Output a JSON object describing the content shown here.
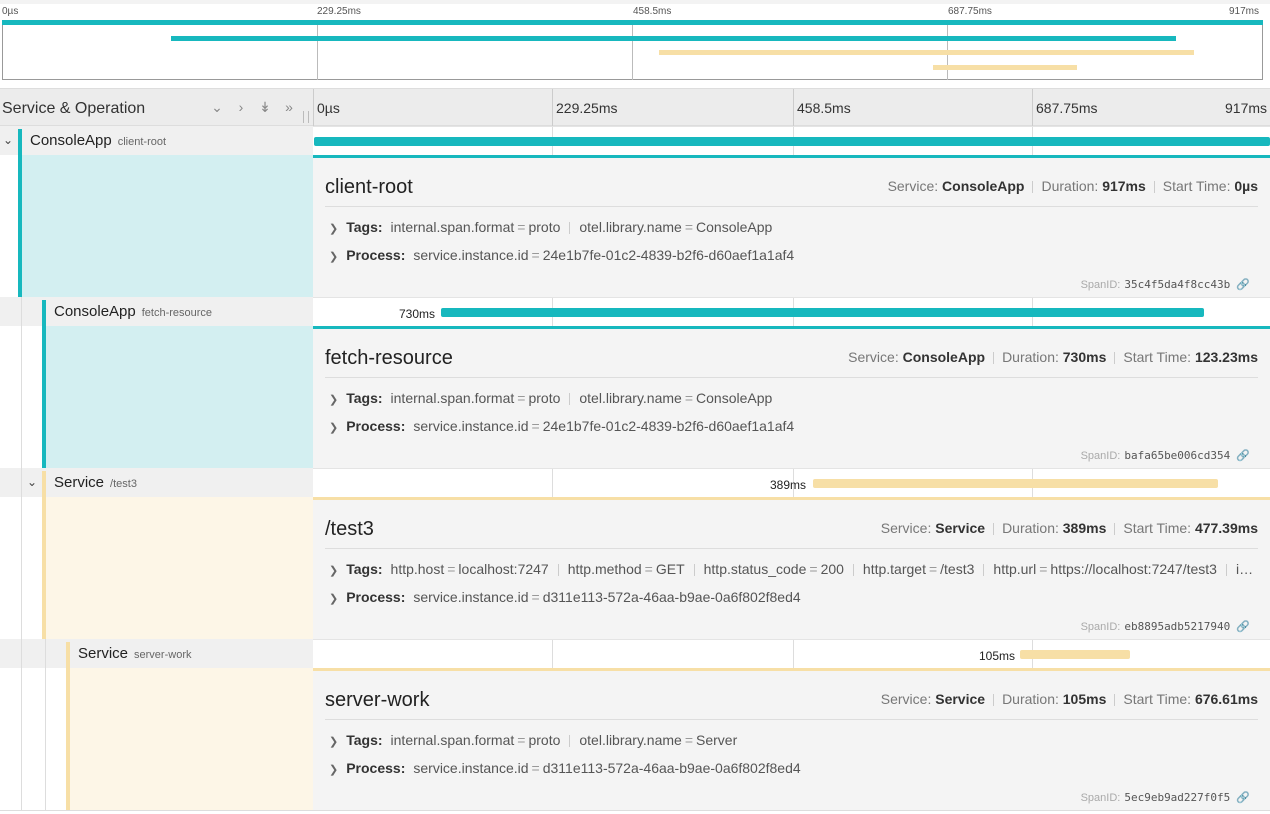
{
  "colors": {
    "client": "#17b8be",
    "server": "#f7dfa6",
    "client_bg": "#d3eff1",
    "server_bg": "#fdf6e7"
  },
  "minimap": {
    "ticks": [
      "0µs",
      "229.25ms",
      "458.5ms",
      "687.75ms",
      "917ms"
    ]
  },
  "header": {
    "title": "Service & Operation",
    "icons": [
      "chevron-down-icon",
      "chevron-right-icon",
      "double-chevron-down-icon",
      "double-chevron-right-icon"
    ],
    "ticks": [
      "0µs",
      "229.25ms",
      "458.5ms",
      "687.75ms",
      "917ms"
    ]
  },
  "spans": [
    {
      "service": "ConsoleApp",
      "operation": "client-root",
      "duration_label": "",
      "title": "client-root",
      "meta": {
        "service_label": "Service:",
        "service": "ConsoleApp",
        "duration_label": "Duration:",
        "duration": "917ms",
        "start_label": "Start Time:",
        "start": "0µs"
      },
      "tags_label": "Tags:",
      "tags": [
        {
          "k": "internal.span.format",
          "v": "proto"
        },
        {
          "k": "otel.library.name",
          "v": "ConsoleApp"
        }
      ],
      "process_label": "Process:",
      "process": [
        {
          "k": "service.instance.id",
          "v": "24e1b7fe-01c2-4839-b2f6-d60aef1a1af4"
        }
      ],
      "spanid_label": "SpanID:",
      "spanid": "35c4f5da4f8cc43b"
    },
    {
      "service": "ConsoleApp",
      "operation": "fetch-resource",
      "duration_label": "730ms",
      "title": "fetch-resource",
      "meta": {
        "service_label": "Service:",
        "service": "ConsoleApp",
        "duration_label": "Duration:",
        "duration": "730ms",
        "start_label": "Start Time:",
        "start": "123.23ms"
      },
      "tags_label": "Tags:",
      "tags": [
        {
          "k": "internal.span.format",
          "v": "proto"
        },
        {
          "k": "otel.library.name",
          "v": "ConsoleApp"
        }
      ],
      "process_label": "Process:",
      "process": [
        {
          "k": "service.instance.id",
          "v": "24e1b7fe-01c2-4839-b2f6-d60aef1a1af4"
        }
      ],
      "spanid_label": "SpanID:",
      "spanid": "bafa65be006cd354"
    },
    {
      "service": "Service",
      "operation": "/test3",
      "duration_label": "389ms",
      "title": "/test3",
      "meta": {
        "service_label": "Service:",
        "service": "Service",
        "duration_label": "Duration:",
        "duration": "389ms",
        "start_label": "Start Time:",
        "start": "477.39ms"
      },
      "tags_label": "Tags:",
      "tags": [
        {
          "k": "http.host",
          "v": "localhost:7247"
        },
        {
          "k": "http.method",
          "v": "GET"
        },
        {
          "k": "http.status_code",
          "v": "200"
        },
        {
          "k": "http.target",
          "v": "/test3"
        },
        {
          "k": "http.url",
          "v": "https://localhost:7247/test3"
        }
      ],
      "tags_overflow": "i…",
      "process_label": "Process:",
      "process": [
        {
          "k": "service.instance.id",
          "v": "d311e113-572a-46aa-b9ae-0a6f802f8ed4"
        }
      ],
      "spanid_label": "SpanID:",
      "spanid": "eb8895adb5217940"
    },
    {
      "service": "Service",
      "operation": "server-work",
      "duration_label": "105ms",
      "title": "server-work",
      "meta": {
        "service_label": "Service:",
        "service": "Service",
        "duration_label": "Duration:",
        "duration": "105ms",
        "start_label": "Start Time:",
        "start": "676.61ms"
      },
      "tags_label": "Tags:",
      "tags": [
        {
          "k": "internal.span.format",
          "v": "proto"
        },
        {
          "k": "otel.library.name",
          "v": "Server"
        }
      ],
      "process_label": "Process:",
      "process": [
        {
          "k": "service.instance.id",
          "v": "d311e113-572a-46aa-b9ae-0a6f802f8ed4"
        }
      ],
      "spanid_label": "SpanID:",
      "spanid": "5ec9eb9ad227f0f5"
    }
  ]
}
